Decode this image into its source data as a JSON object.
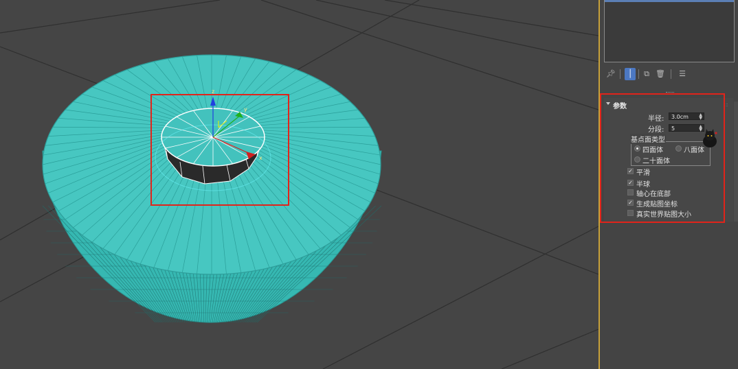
{
  "viewport": {
    "colors": {
      "background": "#454545",
      "grid_line": "#2e2e2e",
      "mesh": "#3fc4c0",
      "selection": "#ffffff",
      "highlight_box": "#e2231a"
    },
    "gizmo": {
      "z_label": "z",
      "y_label": "y",
      "x_label": "x"
    }
  },
  "toolbar": {
    "icons": [
      "pin-icon",
      "modifier-stack-icon",
      "make-unique-icon",
      "remove-modifier-icon",
      "configure-modifier-sets-icon"
    ]
  },
  "rollout": {
    "title": "参数",
    "radius_label": "半径:",
    "radius_value": "3.0cm",
    "segments_label": "分段:",
    "segments_value": "5",
    "base_type_label": "基点面类型",
    "options": {
      "tetra": "四面体",
      "octa": "八面体",
      "icosa": "二十面体",
      "selected": "四面体"
    },
    "checkboxes": {
      "smooth": "平滑",
      "hemisphere": "半球",
      "base_pivot": "轴心在底部",
      "gen_map_coords": "生成贴图坐标",
      "real_world_map": "真实世界贴图大小"
    },
    "checked": {
      "smooth": true,
      "hemisphere": true,
      "base_pivot": false,
      "gen_map_coords": true,
      "real_world_map": false
    }
  }
}
